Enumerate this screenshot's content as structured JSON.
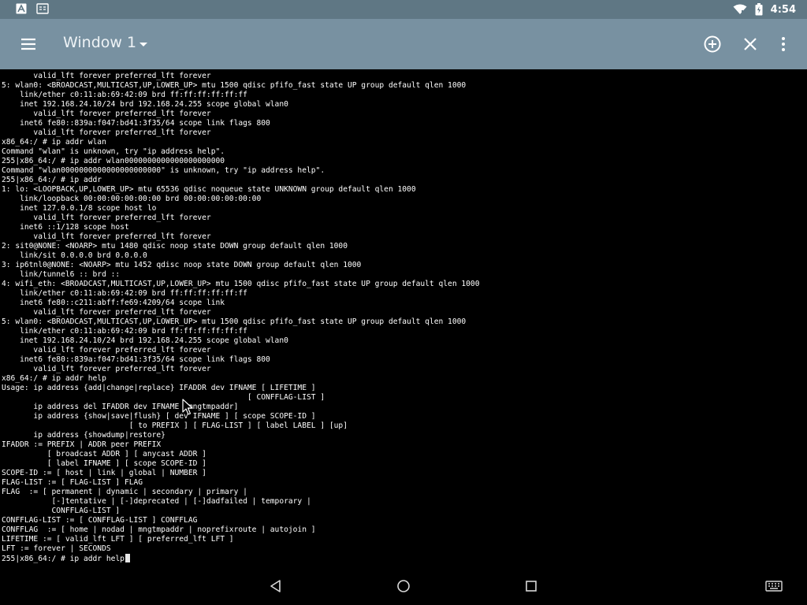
{
  "status_bar": {
    "left_icons": [
      "font-a-icon",
      "sim-toolkit-icon"
    ],
    "right_icons": [
      "wifi-icon",
      "battery-icon"
    ],
    "time": "4:54"
  },
  "app_bar": {
    "window_title": "Window 1",
    "icons": [
      "menu-icon",
      "dropdown-arrow-icon",
      "add-window-icon",
      "close-window-icon",
      "overflow-menu-icon"
    ]
  },
  "terminal": {
    "lines": [
      "       valid_lft forever preferred_lft forever",
      "5: wlan0: <BROADCAST,MULTICAST,UP,LOWER_UP> mtu 1500 qdisc pfifo_fast state UP group default qlen 1000",
      "    link/ether c0:11:ab:69:42:09 brd ff:ff:ff:ff:ff:ff",
      "    inet 192.168.24.10/24 brd 192.168.24.255 scope global wlan0",
      "       valid_lft forever preferred_lft forever",
      "    inet6 fe80::839a:f047:bd41:3f35/64 scope link flags 800",
      "       valid_lft forever preferred_lft forever",
      "x86_64:/ # ip addr wlan",
      "Command \"wlan\" is unknown, try \"ip address help\".",
      "255|x86_64:/ # ip addr wlan0000000000000000000000",
      "Command \"wlan0000000000000000000000\" is unknown, try \"ip address help\".",
      "255|x86_64:/ # ip addr",
      "1: lo: <LOOPBACK,UP,LOWER_UP> mtu 65536 qdisc noqueue state UNKNOWN group default qlen 1000",
      "    link/loopback 00:00:00:00:00:00 brd 00:00:00:00:00:00",
      "    inet 127.0.0.1/8 scope host lo",
      "       valid_lft forever preferred_lft forever",
      "    inet6 ::1/128 scope host",
      "       valid_lft forever preferred_lft forever",
      "2: sit0@NONE: <NOARP> mtu 1480 qdisc noop state DOWN group default qlen 1000",
      "    link/sit 0.0.0.0 brd 0.0.0.0",
      "3: ip6tnl0@NONE: <NOARP> mtu 1452 qdisc noop state DOWN group default qlen 1000",
      "    link/tunnel6 :: brd ::",
      "4: wifi_eth: <BROADCAST,MULTICAST,UP,LOWER_UP> mtu 1500 qdisc pfifo_fast state UP group default qlen 1000",
      "    link/ether c0:11:ab:69:42:09 brd ff:ff:ff:ff:ff:ff",
      "    inet6 fe80::c211:abff:fe69:4209/64 scope link",
      "       valid_lft forever preferred_lft forever",
      "5: wlan0: <BROADCAST,MULTICAST,UP,LOWER_UP> mtu 1500 qdisc pfifo_fast state UP group default qlen 1000",
      "    link/ether c0:11:ab:69:42:09 brd ff:ff:ff:ff:ff:ff",
      "    inet 192.168.24.10/24 brd 192.168.24.255 scope global wlan0",
      "       valid_lft forever preferred_lft forever",
      "    inet6 fe80::839a:f047:bd41:3f35/64 scope link flags 800",
      "       valid_lft forever preferred_lft forever",
      "x86_64:/ # ip addr help",
      "Usage: ip address {add|change|replace} IFADDR dev IFNAME [ LIFETIME ]",
      "                                                      [ CONFFLAG-LIST ]",
      "       ip address del IFADDR dev IFNAME [mngtmpaddr]",
      "       ip address {show|save|flush} [ dev IFNAME ] [ scope SCOPE-ID ]",
      "                            [ to PREFIX ] [ FLAG-LIST ] [ label LABEL ] [up]",
      "       ip address {showdump|restore}",
      "IFADDR := PREFIX | ADDR peer PREFIX",
      "          [ broadcast ADDR ] [ anycast ADDR ]",
      "          [ label IFNAME ] [ scope SCOPE-ID ]",
      "SCOPE-ID := [ host | link | global | NUMBER ]",
      "FLAG-LIST := [ FLAG-LIST ] FLAG",
      "FLAG  := [ permanent | dynamic | secondary | primary |",
      "           [-]tentative | [-]deprecated | [-]dadfailed | temporary |",
      "           CONFFLAG-LIST ]",
      "CONFFLAG-LIST := [ CONFFLAG-LIST ] CONFFLAG",
      "CONFFLAG  := [ home | nodad | mngtmpaddr | noprefixroute | autojoin ]",
      "LIFETIME := [ valid_lft LFT ] [ preferred_lft LFT ]",
      "LFT := forever | SECONDS"
    ],
    "prompt_line": "255|x86_64:/ # ip addr help"
  },
  "nav_bar": {
    "icons": [
      "back-icon",
      "home-icon",
      "recents-icon",
      "keyboard-icon"
    ]
  },
  "colors": {
    "status_bar": "#5f7784",
    "app_bar": "#7891a1",
    "terminal_bg": "#000000",
    "terminal_text": "#ffffff"
  }
}
